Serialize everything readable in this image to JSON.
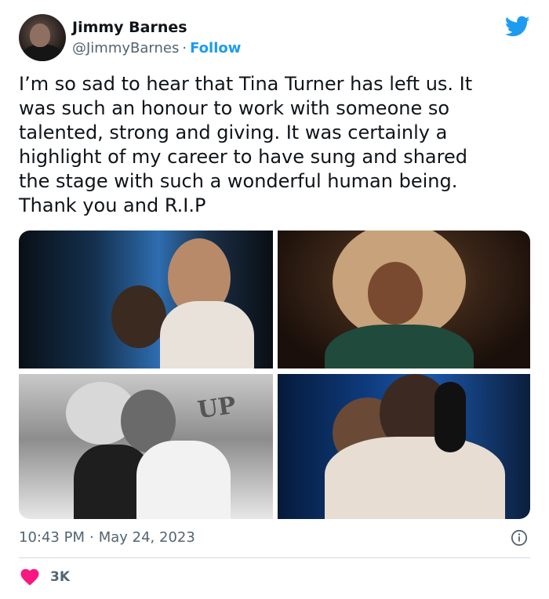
{
  "author": {
    "name": "Jimmy Barnes",
    "handle": "@JimmyBarnes",
    "separator": "·",
    "follow_label": "Follow"
  },
  "tweet": {
    "text": "I’m so sad to hear that Tina Turner has left us. It\nwas such an honour to work with someone so\ntalented, strong and giving. It was certainly a\nhighlight of my career to have sung and shared\nthe stage with such a wonderful human being.\nThank you and R.I.P"
  },
  "media": {
    "photo_sign_text": "UP"
  },
  "meta": {
    "time": "10:43 PM",
    "separator": "·",
    "date": "May 24, 2023"
  },
  "engagement": {
    "likes": "3K"
  },
  "colors": {
    "brand": "#1d9bf0",
    "like": "#f91880",
    "text": "#0f1419",
    "muted": "#536471"
  },
  "icons": {
    "platform": "twitter-bird-icon",
    "info": "info-icon",
    "like": "heart-icon"
  }
}
